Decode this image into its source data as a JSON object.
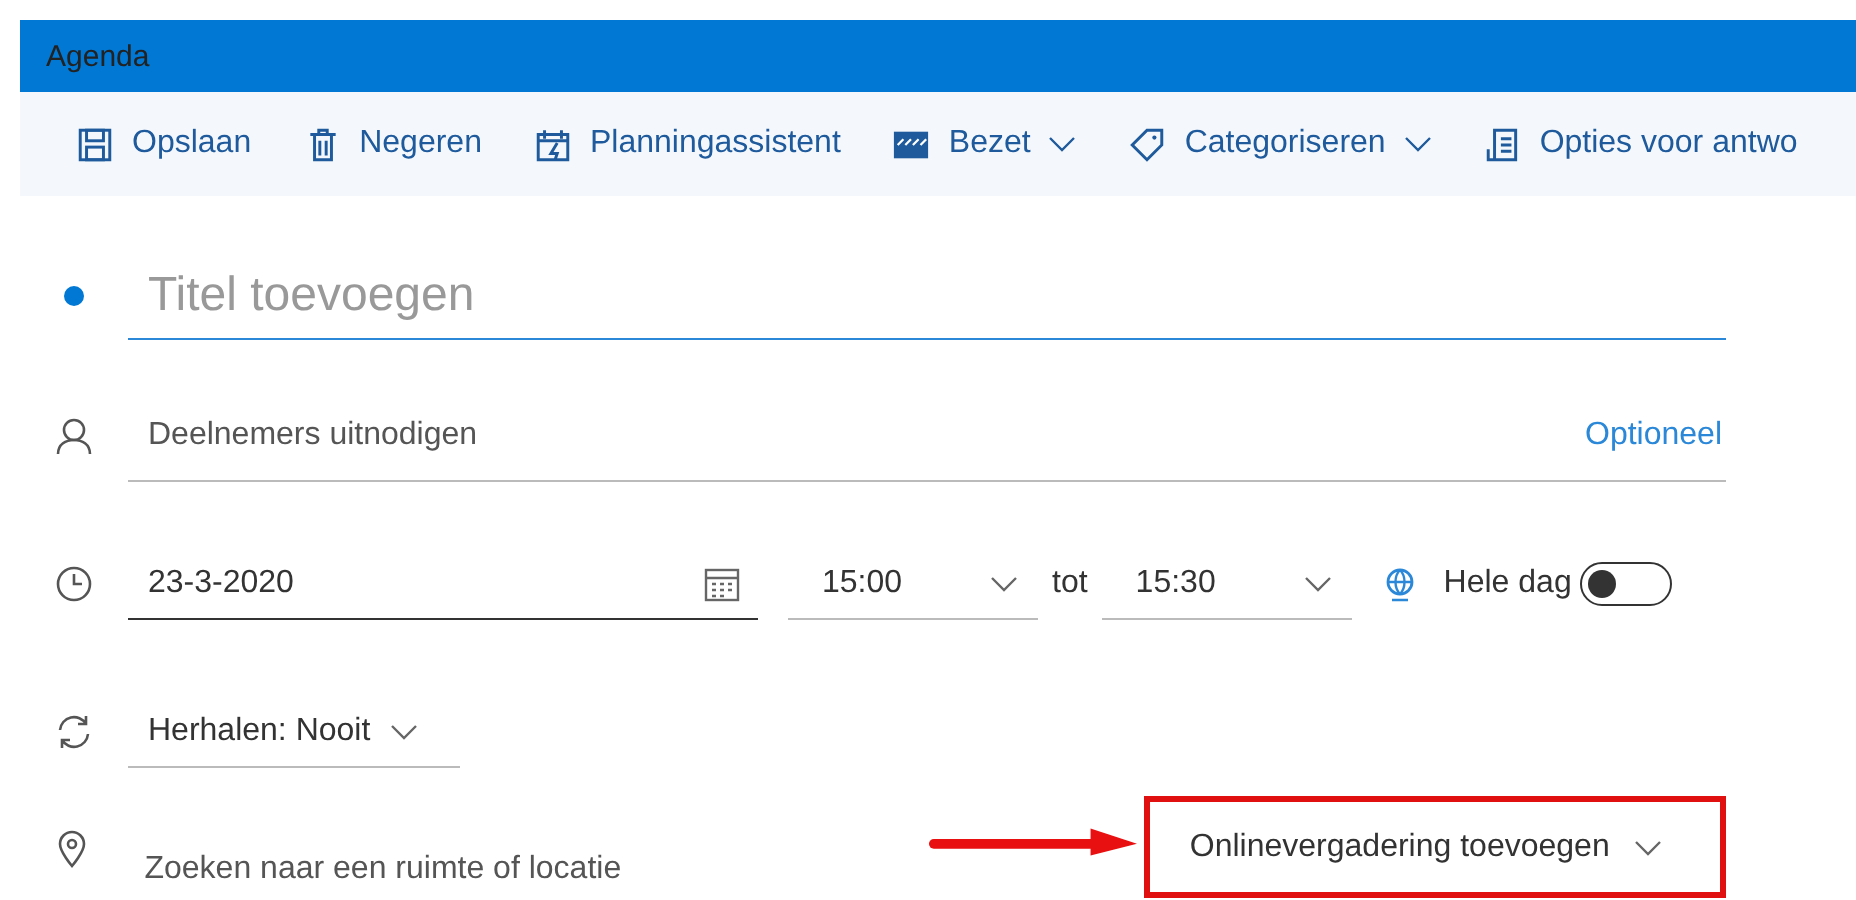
{
  "header": {
    "title": "Agenda"
  },
  "toolbar": [
    {
      "kind": "save",
      "label": "Opslaan",
      "dropdown": false
    },
    {
      "kind": "trash",
      "label": "Negeren",
      "dropdown": false
    },
    {
      "kind": "calendar-edit",
      "label": "Planningassistent",
      "dropdown": false
    },
    {
      "kind": "busy",
      "label": "Bezet",
      "dropdown": true
    },
    {
      "kind": "tag",
      "label": "Categoriseren",
      "dropdown": true
    },
    {
      "kind": "list",
      "label": "Opties voor antwo",
      "dropdown": false
    }
  ],
  "title_field": {
    "placeholder": "Titel toevoegen"
  },
  "attendees": {
    "placeholder": "Deelnemers uitnodigen",
    "optional_link": "Optioneel"
  },
  "date": {
    "value": "23-3-2020"
  },
  "start_time": {
    "value": "15:00"
  },
  "connector": "tot",
  "end_time": {
    "value": "15:30"
  },
  "all_day": {
    "label": "Hele dag",
    "on": false
  },
  "repeat": {
    "label": "Herhalen:",
    "value": "Nooit"
  },
  "location": {
    "placeholder": "Zoeken naar een ruimte of locatie"
  },
  "online_meeting": {
    "label": "Onlinevergadering toevoegen",
    "highlighted": true
  }
}
